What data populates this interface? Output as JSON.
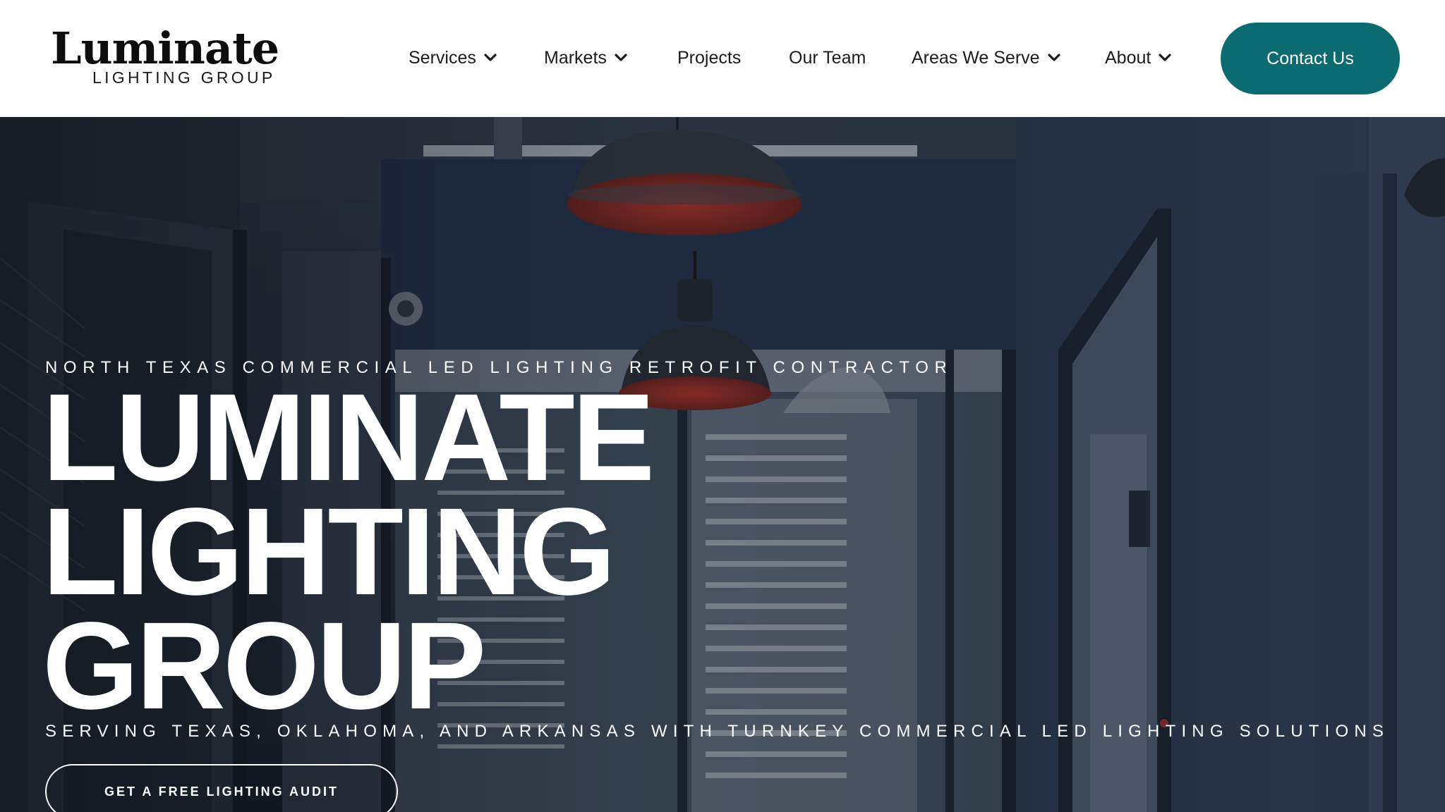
{
  "brand": {
    "name": "Luminate",
    "subtitle": "LIGHTING GROUP"
  },
  "nav": {
    "items": [
      {
        "label": "Services",
        "has_dropdown": true
      },
      {
        "label": "Markets",
        "has_dropdown": true
      },
      {
        "label": "Projects",
        "has_dropdown": false
      },
      {
        "label": "Our Team",
        "has_dropdown": false
      },
      {
        "label": "Areas We Serve",
        "has_dropdown": true
      },
      {
        "label": "About",
        "has_dropdown": true
      }
    ],
    "contact_label": "Contact Us"
  },
  "hero": {
    "eyebrow": "NORTH TEXAS COMMERCIAL LED LIGHTING RETROFIT CONTRACTOR",
    "title_lines": [
      "LUMINATE",
      "LIGHTING",
      "GROUP"
    ],
    "tagline": "SERVING TEXAS, OKLAHOMA, AND ARKANSAS WITH TURNKEY COMMERCIAL LED LIGHTING SOLUTIONS",
    "cta_label": "GET A FREE LIGHTING AUDIT"
  },
  "colors": {
    "accent": "#0c6b70",
    "header_bg": "#ffffff",
    "hero_overlay": "#2a3646",
    "lamp_interior": "#8a2a24"
  },
  "icons": {
    "dropdown": "chevron-down-icon"
  }
}
